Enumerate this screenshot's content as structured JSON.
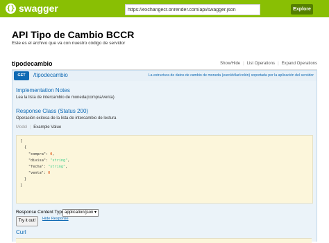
{
  "header": {
    "logo_glyph": "{}",
    "logo_text": "swagger",
    "url_value": "https://exchangecr.onrender.com/api/swagger.json",
    "explore_label": "Explore",
    "brand_color": "#89bf04"
  },
  "info": {
    "title": "API Tipo de Cambio BCCR",
    "description": "Este es el archivo que va con nuestro código de servidor"
  },
  "resource": {
    "name": "tipodecambio",
    "links": [
      "Show/Hide",
      "List Operations",
      "Expand Operations"
    ]
  },
  "operation": {
    "method": "GET",
    "path": "/tipodecambio",
    "summary": "La estructura de datos de cambio de moneda (euro/dólar/colón) soportada por la aplicación del servidor",
    "implementation_notes_heading": "Implementation Notes",
    "implementation_notes": "Lea la lista de intercambio de moneda(compra/venta)",
    "response_class_heading": "Response Class (Status 200)",
    "response_class_desc": "Operación exitosa de la lista de intercambio de lectura",
    "model_tab": "Model",
    "example_tab": "Example Value",
    "example_json": {
      "open_array": "[",
      "open_obj": "{",
      "fields": [
        {
          "key": "\"compra\"",
          "value": "0",
          "kind": "number",
          "trail": ","
        },
        {
          "key": "\"divisa\"",
          "value": "\"string\"",
          "kind": "string",
          "trail": ","
        },
        {
          "key": "\"fecha\"",
          "value": "\"string\"",
          "kind": "string",
          "trail": ","
        },
        {
          "key": "\"venta\"",
          "value": "0",
          "kind": "number",
          "trail": ""
        }
      ],
      "close_obj": "}",
      "close_array": "]"
    },
    "response_content_type_label": "Response Content Type",
    "content_type_value": "application/json",
    "try_label": "Try it out!",
    "hide_response_label": "Hide Response",
    "curl_heading": "Curl"
  }
}
